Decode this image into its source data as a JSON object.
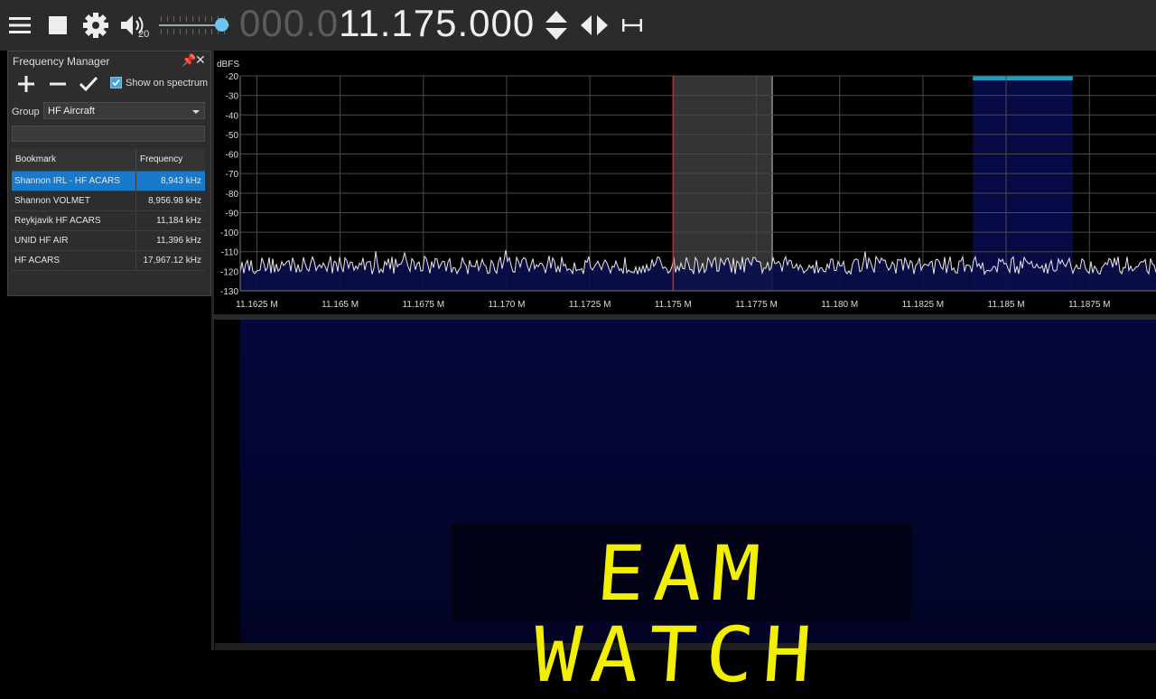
{
  "toolbar": {
    "menu_icon": "hamburger-menu-icon",
    "stop_icon": "stop-icon",
    "settings_icon": "gear-icon",
    "volume_icon": "speaker-icon",
    "volume_level": "20",
    "volume_fraction": 0.87,
    "frequency_dim": "000.0",
    "frequency_main": "11.175.000",
    "tune_icon": "up-down-arrows-icon",
    "step_icon": "left-right-arrows-icon",
    "span_icon": "span-icon"
  },
  "freq_manager": {
    "title": "Frequency Manager",
    "show_on_spectrum": "Show on spectrum",
    "group_label": "Group",
    "group_value": "HF Aircraft",
    "search_value": "",
    "columns": [
      "Bookmark",
      "Frequency"
    ],
    "rows": [
      {
        "name": "Shannon IRL - HF ACARS",
        "freq": "8,943 kHz"
      },
      {
        "name": "Shannon VOLMET",
        "freq": "8,956.98 kHz"
      },
      {
        "name": "Reykjavik HF ACARS",
        "freq": "11,184 kHz"
      },
      {
        "name": "UNID HF AIR",
        "freq": "11,396 kHz"
      },
      {
        "name": "HF ACARS",
        "freq": "17,967.12 kHz"
      }
    ]
  },
  "spectrum": {
    "unit_label": "dBFS",
    "db_ticks": [
      "-20",
      "-30",
      "-40",
      "-50",
      "-60",
      "-70",
      "-80",
      "-90",
      "-100",
      "-110",
      "-120",
      "-130"
    ],
    "freq_ticks": [
      "11.1625 M",
      "11.165 M",
      "11.1675 M",
      "11.170 M",
      "11.1725 M",
      "11.175 M",
      "11.1775 M",
      "11.180 M",
      "11.1825 M",
      "11.185 M",
      "11.1875 M"
    ],
    "x_range_mhz": [
      11.162,
      11.1895
    ],
    "y_range_db": [
      -130,
      -20
    ],
    "tuned_mhz": 11.175,
    "filter_mhz": [
      11.175,
      11.178
    ],
    "bookmark_band_mhz": [
      11.184,
      11.187
    ],
    "noise_floor_db": -117,
    "trace_color": "#e8e8e8",
    "bookmark_color": "#1a9fc0"
  },
  "waterfall": {
    "caption": "EAM WATCH"
  }
}
